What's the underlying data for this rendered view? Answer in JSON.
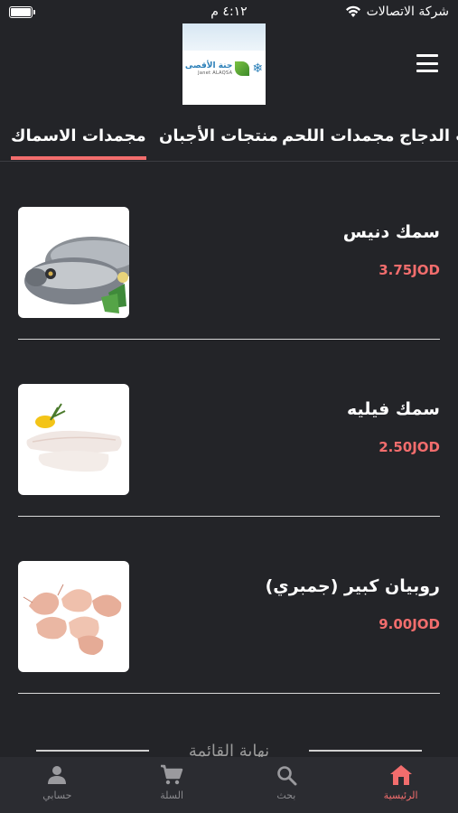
{
  "status_bar": {
    "carrier": "شركة الاتصالات",
    "time": "٤:١٢ م",
    "battery_level": 1.0
  },
  "header": {
    "logo_text_ar": "جنة الأقصى",
    "logo_text_en": "Janet ALAQSA",
    "menu_icon": "hamburger-menu-icon"
  },
  "tabs": [
    {
      "label": "مجمدات الاسماك",
      "active": true
    },
    {
      "label": "منتجات الأجبان",
      "active": false
    },
    {
      "label": "مجمدات اللحم",
      "active": false
    },
    {
      "label": "مجمدات الدجاج",
      "active": false
    }
  ],
  "products": [
    {
      "name": "سمك دنيس",
      "price": "3.75JOD",
      "image": "sea-bream-fish-image"
    },
    {
      "name": "سمك فيليه",
      "price": "2.50JOD",
      "image": "fish-fillet-image"
    },
    {
      "name": "روبيان كبير (جمبري)",
      "price": "9.00JOD",
      "image": "shrimp-image"
    }
  ],
  "list_end_label": "نهاية القائمة",
  "bottom_nav": [
    {
      "label": "الرئيسية",
      "icon": "home-icon",
      "active": true
    },
    {
      "label": "بحث",
      "icon": "search-icon",
      "active": false
    },
    {
      "label": "السلة",
      "icon": "cart-icon",
      "active": false
    },
    {
      "label": "حسابي",
      "icon": "person-icon",
      "active": false
    }
  ],
  "colors": {
    "background": "#232428",
    "accent": "#f26d6d",
    "nav_background": "#2b2c31"
  }
}
